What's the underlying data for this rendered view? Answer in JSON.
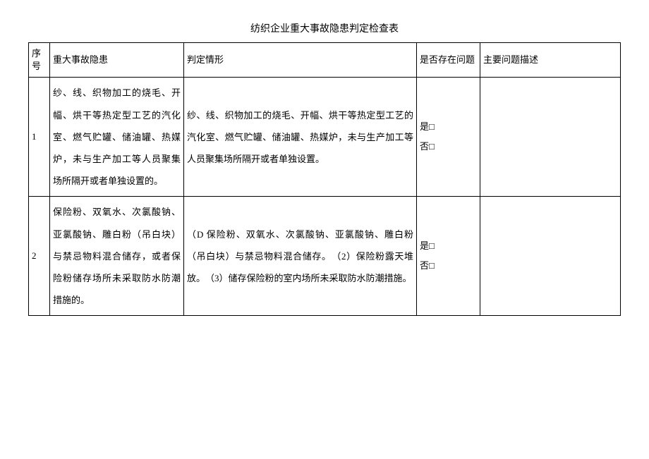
{
  "title": "纺织企业重大事故隐患判定检查表",
  "headers": {
    "seq": "序号",
    "hazard": "重大事故隐患",
    "situation": "判定情形",
    "exist": "是否存在问题",
    "desc": "主要问题描述"
  },
  "checkbox_yes": "是□",
  "checkbox_no": "否□",
  "rows": [
    {
      "seq": "1",
      "hazard": "纱、线、织物加工的烧毛、开幅、烘干等热定型工艺的汽化室、燃气贮罐、储油罐、热媒炉，未与生产加工等人员聚集场所隔开或者单独设置的。",
      "situation": "纱、线、织物加工的烧毛、开幅、烘干等热定型工艺的汽化室、燃气贮罐、储油罐、热媒炉，未与生产加工等人员聚集场所隔开或者单独设置。",
      "desc": ""
    },
    {
      "seq": "2",
      "hazard": "保险粉、双氧水、次氯酸钠、亚氯酸钠、雕白粉（吊白块）与禁忌物料混合储存，或者保险粉储存场所未采取防水防潮措施的。",
      "situation": "（D 保险粉、双氧水、次氯酸钠、亚氯酸钠、雕白粉（吊白块）与禁忌物料混合储存。　（2）保险粉露天堆放。　（3）储存保险粉的室内场所未采取防水防潮措施。",
      "desc": ""
    }
  ]
}
